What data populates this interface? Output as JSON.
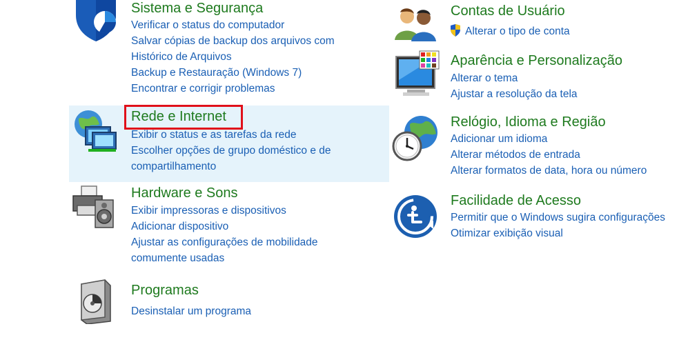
{
  "left": [
    {
      "title": "Sistema e Segurança",
      "icon": "shield-icon",
      "links": [
        "Verificar o status do computador",
        "Salvar cópias de backup dos arquivos com",
        "Histórico de Arquivos",
        "Backup e Restauração (Windows 7)",
        "Encontrar e corrigir problemas"
      ]
    },
    {
      "title": "Rede e Internet",
      "icon": "network-globe-icon",
      "links": [
        "Exibir o status e as tarefas da rede",
        "Escolher opções de grupo doméstico e de",
        "compartilhamento"
      ]
    },
    {
      "title": "Hardware e Sons",
      "icon": "printer-speaker-icon",
      "links": [
        "Exibir impressoras e dispositivos",
        "Adicionar dispositivo",
        "Ajustar as configurações de mobilidade",
        "comumente usadas"
      ]
    },
    {
      "title": "Programas",
      "icon": "programs-disc-icon",
      "links": [
        "Desinstalar um programa"
      ]
    }
  ],
  "right": [
    {
      "title": "Contas de Usuário",
      "icon": "users-icon",
      "links": [
        "Alterar o tipo de conta"
      ]
    },
    {
      "title": "Aparência e Personalização",
      "icon": "monitor-palette-icon",
      "links": [
        "Alterar o tema",
        "Ajustar a resolução da tela"
      ]
    },
    {
      "title": "Relógio, Idioma e Região",
      "icon": "clock-globe-icon",
      "links": [
        "Adicionar um idioma",
        "Alterar métodos de entrada",
        "Alterar formatos de data, hora ou número"
      ]
    },
    {
      "title": "Facilidade de Acesso",
      "icon": "ease-of-access-icon",
      "links": [
        "Permitir que o Windows sugira configurações",
        "Otimizar exibição visual"
      ]
    }
  ],
  "colors": {
    "title": "#1e7a1e",
    "link": "#1a5fb4",
    "highlight": "#e5f3fb",
    "annotation": "#e0101a"
  }
}
